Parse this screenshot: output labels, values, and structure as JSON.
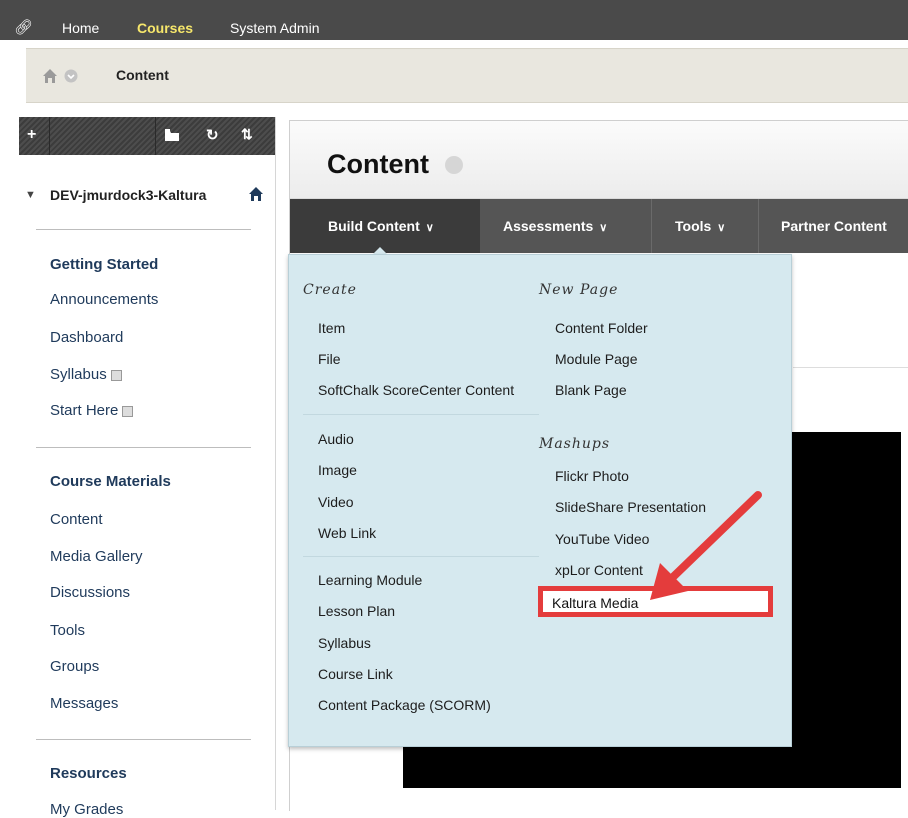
{
  "topnav": {
    "tabs": [
      "Home",
      "Courses",
      "System Admin"
    ],
    "active": "Courses"
  },
  "breadcrumb": {
    "current": "Content"
  },
  "course_menu": {
    "course_title": "DEV-jmurdock3-Kaltura",
    "sections": [
      {
        "heading": "Getting Started",
        "items": [
          {
            "label": "Announcements",
            "hidden": false
          },
          {
            "label": "Dashboard",
            "hidden": false
          },
          {
            "label": "Syllabus",
            "hidden": true
          },
          {
            "label": "Start Here",
            "hidden": true
          }
        ]
      },
      {
        "heading": "Course Materials",
        "items": [
          {
            "label": "Content",
            "hidden": false
          },
          {
            "label": "Media Gallery",
            "hidden": false
          },
          {
            "label": "Discussions",
            "hidden": false
          },
          {
            "label": "Tools",
            "hidden": false
          },
          {
            "label": "Groups",
            "hidden": false
          },
          {
            "label": "Messages",
            "hidden": false
          }
        ]
      },
      {
        "heading": "Resources",
        "items": [
          {
            "label": "My Grades",
            "hidden": false
          }
        ]
      }
    ]
  },
  "content_area": {
    "title": "Content",
    "action_bar": [
      "Build Content",
      "Assessments",
      "Tools",
      "Partner Content"
    ]
  },
  "build_menu": {
    "create_heading": "Create",
    "create_group1": [
      "Item",
      "File",
      "SoftChalk ScoreCenter Content"
    ],
    "create_group2": [
      "Audio",
      "Image",
      "Video",
      "Web Link"
    ],
    "create_group3": [
      "Learning Module",
      "Lesson Plan",
      "Syllabus",
      "Course Link",
      "Content Package (SCORM)"
    ],
    "new_page_heading": "New Page",
    "new_page_items": [
      "Content Folder",
      "Module Page",
      "Blank Page"
    ],
    "mashups_heading": "Mashups",
    "mashups_items": [
      "Flickr Photo",
      "SlideShare Presentation",
      "YouTube Video",
      "xpLor Content"
    ],
    "highlighted_item": "Kaltura Media"
  },
  "colors": {
    "topnav_bg": "#4a4a4a",
    "active_tab": "#f7e76b",
    "menu_link": "#1f3a5b",
    "dropdown_bg": "#d6e9ef",
    "highlight_red": "#e43c3c"
  }
}
